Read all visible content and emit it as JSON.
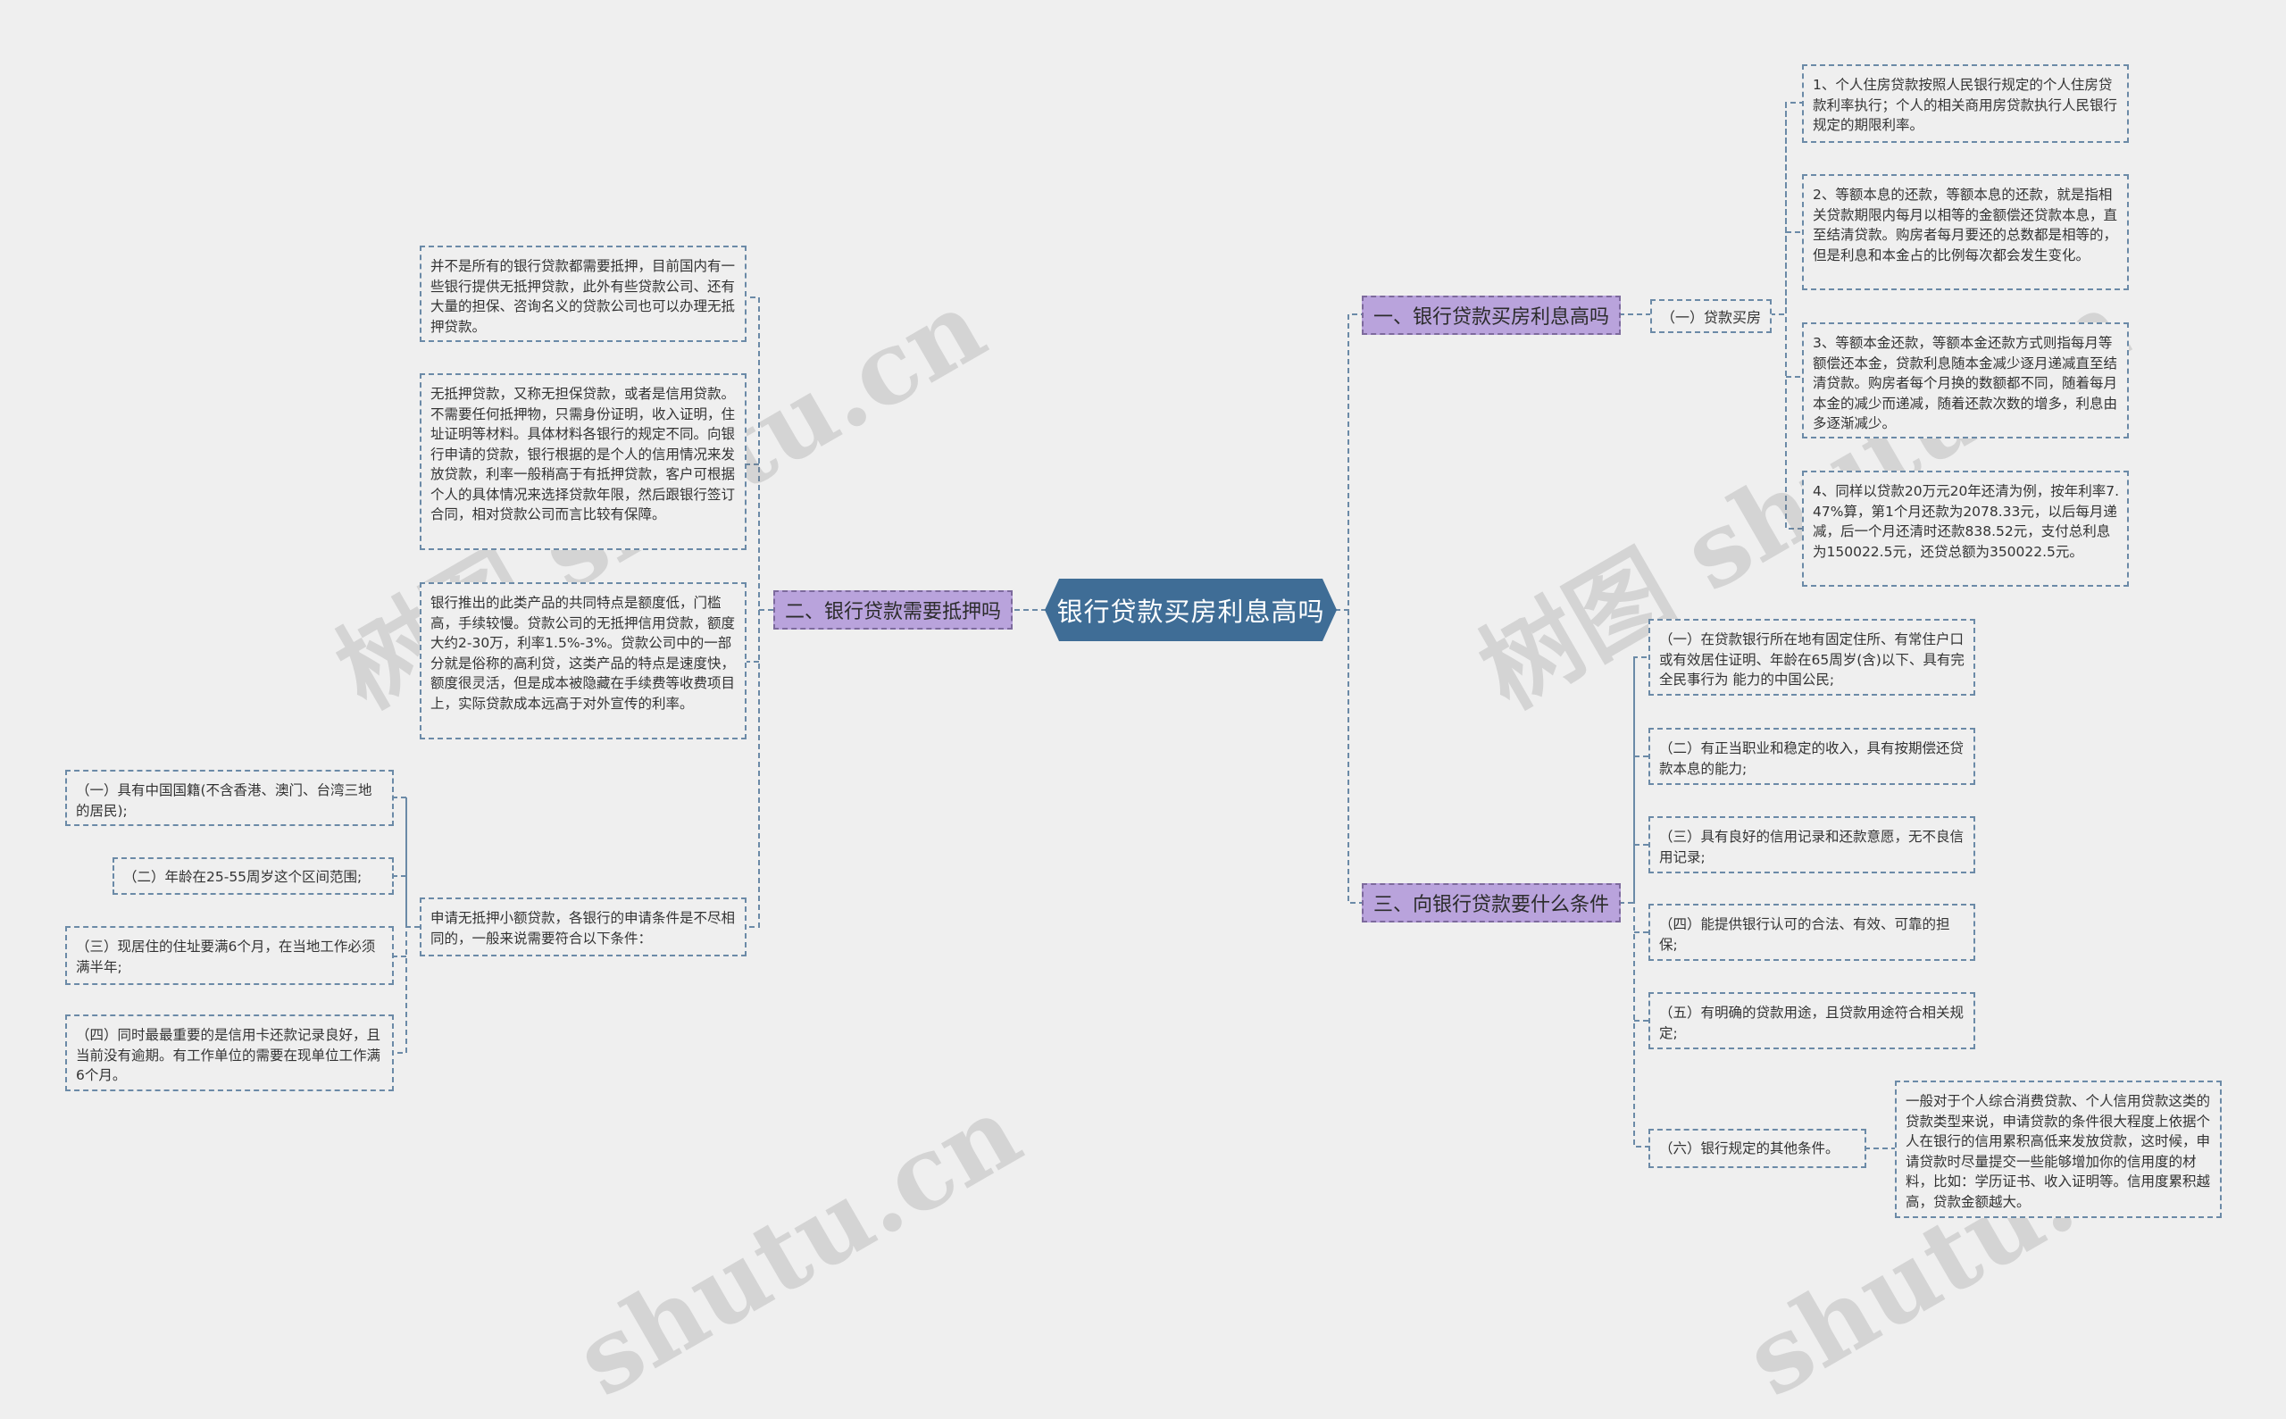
{
  "root": {
    "label": "银行贷款买房利息高吗"
  },
  "branches": [
    {
      "label": "一、银行贷款买房利息高吗",
      "sub": {
        "label": "（一）贷款买房",
        "leaves": [
          "1、个人住房贷款按照人民银行规定的个人住房贷款利率执行；个人的相关商用房贷款执行人民银行规定的期限利率。",
          "2、等额本息的还款，等额本息的还款，就是指相关贷款期限内每月以相等的金额偿还贷款本息，直至结清贷款。购房者每月要还的总数都是相等的，但是利息和本金占的比例每次都会发生变化。",
          "3、等额本金还款，等额本金还款方式则指每月等额偿还本金，贷款利息随本金减少逐月递减直至结清贷款。购房者每个月换的数额都不同，随着每月本金的减少而递减，随着还款次数的增多，利息由多逐渐减少。",
          "4、同样以贷款20万元20年还清为例，按年利率7.47%算，第1个月还款为2078.33元，以后每月递减，后一个月还清时还款838.52元，支付总利息为150022.5元，还贷总额为350022.5元。"
        ]
      }
    },
    {
      "label": "二、银行贷款需要抵押吗",
      "leaves": [
        "并不是所有的银行贷款都需要抵押，目前国内有一些银行提供无抵押贷款，此外有些贷款公司、还有大量的担保、咨询名义的贷款公司也可以办理无抵押贷款。",
        "无抵押贷款，又称无担保贷款，或者是信用贷款。不需要任何抵押物，只需身份证明，收入证明，住址证明等材料。具体材料各银行的规定不同。向银行申请的贷款，银行根据的是个人的信用情况来发放贷款，利率一般稍高于有抵押贷款，客户可根据个人的具体情况来选择贷款年限，然后跟银行签订合同，相对贷款公司而言比较有保障。",
        "银行推出的此类产品的共同特点是额度低，门槛高，手续较慢。贷款公司的无抵押信用贷款，额度大约2-30万，利率1.5%-3%。贷款公司中的一部分就是俗称的高利贷，这类产品的特点是速度快，额度很灵活，但是成本被隐藏在手续费等收费项目上，实际贷款成本远高于对外宣传的利率。",
        "申请无抵押小额贷款，各银行的申请条件是不尽相同的，一般来说需要符合以下条件："
      ],
      "conditions": [
        "（一）具有中国国籍(不含香港、澳门、台湾三地的居民);",
        "（二）年龄在25-55周岁这个区间范围;",
        "（三）现居住的住址要满6个月，在当地工作必须满半年;",
        "（四）同时最最重要的是信用卡还款记录良好，且当前没有逾期。有工作单位的需要在现单位工作满6个月。"
      ]
    },
    {
      "label": "三、向银行贷款要什么条件",
      "leaves": [
        "（一）在贷款银行所在地有固定住所、有常住户口或有效居住证明、年龄在65周岁(含)以下、具有完全民事行为 能力的中国公民;",
        "（二）有正当职业和稳定的收入，具有按期偿还贷款本息的能力;",
        "（三）具有良好的信用记录和还款意愿，无不良信用记录;",
        "（四）能提供银行认可的合法、有效、可靠的担保;",
        "（五）有明确的贷款用途，且贷款用途符合相关规定;",
        "（六）银行规定的其他条件。"
      ],
      "note": "一般对于个人综合消费贷款、个人信用贷款这类的贷款类型来说，申请贷款的条件很大程度上依据个人在银行的信用累积高低来发放贷款，这时候，申请贷款时尽量提交一些能够增加你的信用度的材料，比如：学历证书、收入证明等。信用度累积越高，贷款金额越大。"
    }
  ],
  "watermarks": [
    "树图 shutu.cn",
    "树图 shutu.cn",
    "shutu.cn",
    "shutu.cn"
  ],
  "colors": {
    "root": "#3f6d96",
    "branch": "#b9a3dc",
    "line": "#6b8aa7",
    "background": "#efefef"
  }
}
